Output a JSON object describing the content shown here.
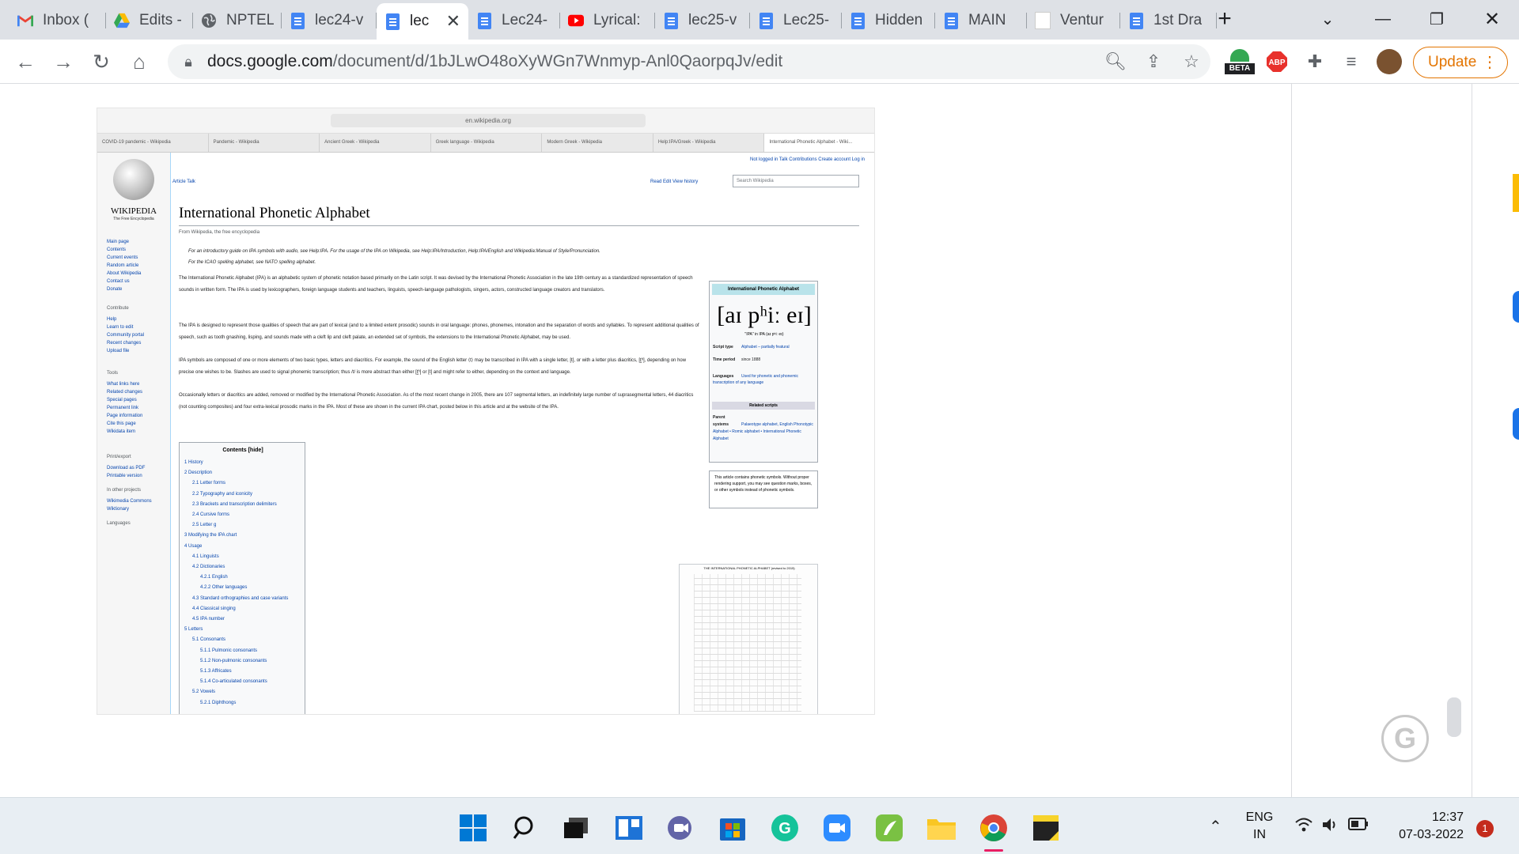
{
  "tabs": [
    {
      "label": "Inbox (",
      "icon": "gmail-icon"
    },
    {
      "label": "Edits -",
      "icon": "drive-icon"
    },
    {
      "label": "NPTEL",
      "icon": "globe-icon"
    },
    {
      "label": "lec24-v",
      "icon": "docs-icon"
    },
    {
      "label": "lec",
      "icon": "docs-icon",
      "active": true
    },
    {
      "label": "Lec24-",
      "icon": "docs-icon"
    },
    {
      "label": "Lyrical:",
      "icon": "youtube-icon"
    },
    {
      "label": "lec25-v",
      "icon": "docs-icon"
    },
    {
      "label": "Lec25-",
      "icon": "docs-icon"
    },
    {
      "label": "Hidden",
      "icon": "docs-icon"
    },
    {
      "label": "MAIN",
      "icon": "docs-icon"
    },
    {
      "label": "Ventur",
      "icon": "blank-icon"
    },
    {
      "label": "1st Dra",
      "icon": "docs-icon"
    }
  ],
  "omnibox": {
    "host": "docs.google.com",
    "path": "/document/d/1bJLwO48oXyWGn7Wnmyp-Anl0QaorpqJv/edit"
  },
  "toolbar": {
    "update_label": "Update",
    "beta_label": "BETA",
    "abp_label": "ABP"
  },
  "screenshot": {
    "url": "en.wikipedia.org",
    "tabs": [
      "COVID-19 pandemic - Wikipedia",
      "Pandemic - Wikipedia",
      "Ancient Greek - Wikipedia",
      "Greek language - Wikipedia",
      "Modern Greek - Wikipedia",
      "Help:IPA/Greek - Wikipedia",
      "International Phonetic Alphabet - Wiki..."
    ],
    "wiki_name": "WIKIPEDIA",
    "wiki_tagline": "The Free Encyclopedia",
    "nav": [
      "Main page",
      "Contents",
      "Current events",
      "Random article",
      "About Wikipedia",
      "Contact us",
      "Donate"
    ],
    "contribute_head": "Contribute",
    "contribute": [
      "Help",
      "Learn to edit",
      "Community portal",
      "Recent changes",
      "Upload file"
    ],
    "tools_head": "Tools",
    "tools": [
      "What links here",
      "Related changes",
      "Special pages",
      "Permanent link",
      "Page information",
      "Cite this page",
      "Wikidata item"
    ],
    "print_head": "Print/export",
    "print": [
      "Download as PDF",
      "Printable version"
    ],
    "other_head": "In other projects",
    "other": [
      "Wikimedia Commons",
      "Wiktionary"
    ],
    "lang_head": "Languages",
    "user_links": "Not logged in  Talk  Contributions  Create account  Log in",
    "tabs_left": "Article   Talk",
    "tabs_right": "Read   Edit   View history",
    "search_placeholder": "Search Wikipedia",
    "title": "International Phonetic Alphabet",
    "from": "From Wikipedia, the free encyclopedia",
    "hatnote1": "For an introductory guide on IPA symbols with audio, see Help:IPA. For the usage of the IPA on Wikipedia, see Help:IPA/Introduction, Help:IPA/English and Wikipedia:Manual of Style/Pronunciation.",
    "hatnote2": "For the ICAO spelling alphabet, see NATO spelling alphabet.",
    "para1": "The International Phonetic Alphabet (IPA) is an alphabetic system of phonetic notation based primarily on the Latin script. It was devised by the International Phonetic Association in the late 19th century as a standardized representation of speech sounds in written form. The IPA is used by lexicographers, foreign language students and teachers, linguists, speech-language pathologists, singers, actors, constructed language creators and translators.",
    "para2": "The IPA is designed to represent those qualities of speech that are part of lexical (and to a limited extent prosodic) sounds in oral language: phones, phonemes, intonation and the separation of words and syllables. To represent additional qualities of speech, such as tooth gnashing, lisping, and sounds made with a cleft lip and cleft palate, an extended set of symbols, the extensions to the International Phonetic Alphabet, may be used.",
    "para3": "IPA symbols are composed of one or more elements of two basic types, letters and diacritics. For example, the sound of the English letter ⟨t⟩ may be transcribed in IPA with a single letter, [t], or with a letter plus diacritics, [t̺ʰ], depending on how precise one wishes to be. Slashes are used to signal phonemic transcription; thus /t/ is more abstract than either [t̺ʰ] or [t] and might refer to either, depending on the context and language.",
    "para4": "Occasionally letters or diacritics are added, removed or modified by the International Phonetic Association. As of the most recent change in 2005, there are 107 segmental letters, an indefinitely large number of suprasegmental letters, 44 diacritics (not counting composites) and four extra-lexical prosodic marks in the IPA. Most of these are shown in the current IPA chart, posted below in this article and at the website of the IPA.",
    "infobox": {
      "head": "International Phonetic Alphabet",
      "ipa": "[aɪ pʰiː eɪ]",
      "sub": "\"IPA\" in IPA (aɪ pʰiː eɪ)",
      "script_type_label": "Script type",
      "script_type": "Alphabet – partially featural",
      "time_label": "Time period",
      "time": "since 1888",
      "lang_label": "Languages",
      "lang": "Used for phonetic and phonemic transcription of any language",
      "related": "Related scripts",
      "parent_label": "Parent systems",
      "parent": "Palaeotype alphabet, English Phonotypic Alphabet • Romic alphabet • International Phonetic Alphabet"
    },
    "notice": "This article contains phonetic symbols. Without proper rendering support, you may see question marks, boxes, or other symbols instead of phonetic symbols.",
    "chart_caption": "THE INTERNATIONAL PHONETIC ALPHABET (revised to 2015)",
    "toc_title": "Contents [hide]",
    "toc": [
      "1 History",
      "2 Description",
      "2.1 Letter forms",
      "2.2 Typography and iconicity",
      "2.3 Brackets and transcription delimiters",
      "2.4 Cursive forms",
      "2.5 Letter g",
      "3 Modifying the IPA chart",
      "4 Usage",
      "4.1 Linguists",
      "4.2 Dictionaries",
      "4.2.1 English",
      "4.2.2 Other languages",
      "4.3 Standard orthographies and case variants",
      "4.4 Classical singing",
      "4.5 IPA number",
      "5 Letters",
      "5.1 Consonants",
      "5.1.1 Pulmonic consonants",
      "5.1.2 Non-pulmonic consonants",
      "5.1.3 Affricates",
      "5.1.4 Co-articulated consonants",
      "5.2 Vowels",
      "5.2.1 Diphthongs"
    ]
  },
  "taskbar": {
    "lang_line1": "ENG",
    "lang_line2": "IN",
    "time": "12:37",
    "date": "07-03-2022",
    "notifications": "1"
  },
  "colors": {
    "accent": "#1a73e8",
    "update": "#e37400",
    "docs_blue": "#4285f4"
  }
}
